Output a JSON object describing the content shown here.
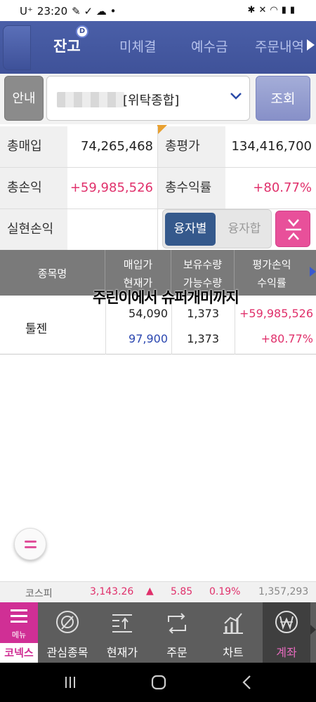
{
  "status_bar": {
    "carrier": "U⁺",
    "time": "23:20",
    "battery": "battery-icon"
  },
  "tabs": [
    {
      "label": "잔고",
      "active": true,
      "badge": "D"
    },
    {
      "label": "미체결",
      "active": false
    },
    {
      "label": "예수금",
      "active": false
    },
    {
      "label": "주문내역",
      "active": false
    }
  ],
  "account": {
    "guide_label": "안내",
    "account_type": "[위탁종합]",
    "query_label": "조회"
  },
  "summary": {
    "total_buy_label": "총매입",
    "total_buy_value": "74,265,468",
    "total_eval_label": "총평가",
    "total_eval_value": "134,416,700",
    "total_pl_label": "총손익",
    "total_pl_value": "+59,985,526",
    "total_return_label": "총수익률",
    "total_return_value": "+80.77%",
    "realized_label": "실현손익",
    "realized_value": ""
  },
  "toggle": {
    "on_label": "융자별",
    "off_label": "융자합"
  },
  "table": {
    "header": {
      "col1": "종목명",
      "col2_line1": "매입가",
      "col2_line2": "현재가",
      "col3_line1": "보유수량",
      "col3_line2": "가능수량",
      "col4_line1": "평가손익",
      "col4_line2": "수익률"
    },
    "rows": [
      {
        "name": "툴젠",
        "buy_price": "54,090",
        "current_price": "97,900",
        "holding_qty": "1,373",
        "available_qty": "1,373",
        "eval_pl": "+59,985,526",
        "return_rate": "+80.77%"
      }
    ]
  },
  "watermark": "주린이에서 슈퍼개미까지",
  "ticker": {
    "index_name": "코스피",
    "value": "3,143.26",
    "change": "5.85",
    "change_rate": "0.19%",
    "volume": "1,357,293"
  },
  "bottom_nav": {
    "menu_label": "메뉴",
    "brand": "코넥스",
    "items": [
      {
        "label": "관심종목",
        "icon": "watchlist-icon"
      },
      {
        "label": "현재가",
        "icon": "price-icon"
      },
      {
        "label": "주문",
        "icon": "order-icon"
      },
      {
        "label": "차트",
        "icon": "chart-icon"
      },
      {
        "label": "계좌",
        "icon": "account-won-icon",
        "active": true
      }
    ]
  },
  "colors": {
    "accent_pink": "#e0306b",
    "tab_bar": "#4a5fa8",
    "current_price_blue": "#2b47b0"
  }
}
